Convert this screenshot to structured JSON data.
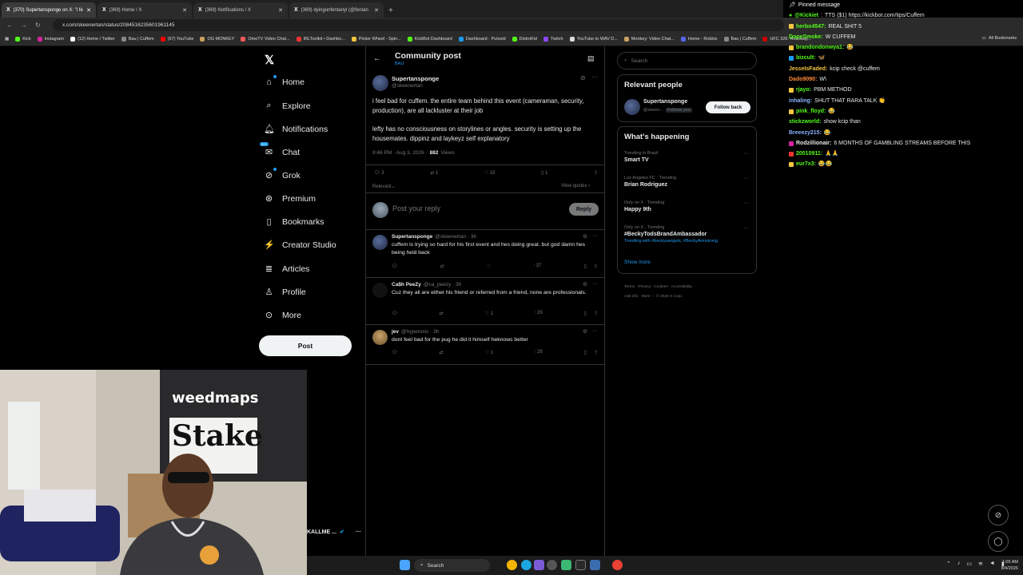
{
  "browser": {
    "tabs": [
      {
        "title": "(370) Supertansponge on X: \"i fe",
        "active": true
      },
      {
        "title": "(369) Home / X",
        "active": false
      },
      {
        "title": "(369) Notifications / X",
        "active": false
      },
      {
        "title": "(369) dyingonfentanyl (@fentan",
        "active": false
      }
    ],
    "url": "x.com/skeenertan/status/2084516235601961145",
    "bookmarks": [
      "Kick",
      "Instagram",
      "(12) Home / Twitter",
      "Bau | Cuffem",
      "(57) YouTube",
      "OG MONKEY",
      "OmeTV Video Chat...",
      "IRLToolkit • Dashbo...",
      "Picker Wheel - Spin...",
      "KickBot Dashboard",
      "Dashboard - Pulsoid",
      "DistroKid",
      "Twitch",
      "YouTube to WAV D...",
      "Monkey: Video Chat...",
      "Home - Roblox",
      "Bau | Cuffem",
      "UFC 326: Holloway..."
    ],
    "all_bookmarks": "All Bookmarks"
  },
  "nav": {
    "items": [
      {
        "label": "Home",
        "icon": "home-icon",
        "glyph": "⌂"
      },
      {
        "label": "Explore",
        "icon": "search-icon",
        "glyph": "⌕"
      },
      {
        "label": "Notifications",
        "icon": "bell-icon",
        "glyph": "♫"
      },
      {
        "label": "Chat",
        "icon": "chat-icon",
        "glyph": "✉"
      },
      {
        "label": "Grok",
        "icon": "grok-icon",
        "glyph": "⊘"
      },
      {
        "label": "Premium",
        "icon": "premium-icon",
        "glyph": "✓"
      },
      {
        "label": "Bookmarks",
        "icon": "bookmark-icon",
        "glyph": "▯"
      },
      {
        "label": "Creator Studio",
        "icon": "creator-studio-icon",
        "glyph": "⚡"
      },
      {
        "label": "Articles",
        "icon": "articles-icon",
        "glyph": "≣"
      },
      {
        "label": "Profile",
        "icon": "profile-icon",
        "glyph": "♙"
      },
      {
        "label": "More",
        "icon": "more-icon",
        "glyph": "⋯"
      }
    ],
    "post_button": "Post",
    "bottom_user": "KALLME ..."
  },
  "main": {
    "title": "Community post",
    "subtitle": "BAU",
    "post": {
      "name": "Supertansponge",
      "handle": "@skeenertan",
      "text1": "i feel bad for cuffem. the entire team behind this event (cameraman, security, production), are all lackluster at their job",
      "text2": "lefty has no consciousness on storylines or angles. security is setting up the housemates. dippinz and laykeyz self explanatory",
      "meta_time": "9:46 PM · Aug 3, 2026 ·",
      "views": "882",
      "views_label": "Views",
      "replies": "3",
      "reposts": "1",
      "likes": "15",
      "bookmarks": "1",
      "relevant": "Relevant",
      "view_quotes": "View quotes"
    },
    "composer": {
      "placeholder": "Post your reply",
      "button": "Reply"
    },
    "replies": [
      {
        "name": "Supertansponge",
        "handle": "@skeenertan · 3h",
        "text": "cuffem is trying so hard for his first event and hes doing great. but god damn hes being held back",
        "replies": "",
        "reposts": "",
        "likes": "",
        "views": "37"
      },
      {
        "name": "Ca$h PeeZy",
        "handle": "@ca_peezy · 3h",
        "text": "Cuz they all are either his friend or referred from a friend, none are professionals.",
        "replies": "",
        "reposts": "",
        "likes": "1",
        "views": "29"
      },
      {
        "name": "jev",
        "handle": "@hyperoxic · 3h",
        "text": "dont feel bad for the pug he did it himself heknows better",
        "replies": "",
        "reposts": "",
        "likes": "1",
        "views": "28"
      }
    ]
  },
  "right": {
    "search_placeholder": "Search",
    "relevant_title": "Relevant people",
    "person": {
      "name": "Supertansponge",
      "handle": "@skeen...",
      "follows": "Follows you",
      "button": "Follow back"
    },
    "happening_title": "What's happening",
    "trends": [
      {
        "context": "Trending in Brazil",
        "title": "Smart TV",
        "extra": ""
      },
      {
        "context": "Los Angeles FC · Trending",
        "title": "Brian Rodriguez",
        "extra": ""
      },
      {
        "context": "Only on X · Trending",
        "title": "Happy 9th",
        "extra": ""
      },
      {
        "context": "Only on X · Trending",
        "title": "#BeckyTodsBrandAmbassador",
        "extra": "Trending with #beckysangels, #BeckyArmstrong"
      }
    ],
    "show_more": "Show more",
    "footer1": "Terms · Privacy · Cookies · Accessibility ·",
    "footer2": "Ads info · More ··· © 2026 X Corp."
  },
  "chat": {
    "pinned_title": "Pinned message",
    "pinned_user": "@Kickiet",
    "pinned_text": "TTS ($1) https://kickbot.com/tips/Cuffem",
    "messages": [
      {
        "user": "herbo4547:",
        "color": "#53fc18",
        "text": "REAL SHIT 5"
      },
      {
        "user": "DopeSmoke:",
        "color": "#53fc18",
        "text": "W CUFFEM"
      },
      {
        "user": "brandondonwya1:",
        "color": "#53fc18",
        "text": "😂"
      },
      {
        "user": "bizcult:",
        "color": "#53fc18",
        "text": "🦋"
      },
      {
        "user": "JesseIsFaded:",
        "color": "#f5c542",
        "text": "kcip check @cuffem"
      },
      {
        "user": "Dado9090:",
        "color": "#ff8a3d",
        "text": "W\\"
      },
      {
        "user": "rjayo:",
        "color": "#53fc18",
        "text": "PBM METHOD"
      },
      {
        "user": "inhaling:",
        "color": "#8ab4ff",
        "text": "SHUT THAT RARA TALK 👏"
      },
      {
        "user": "pink_floyd:",
        "color": "#53fc18",
        "text": "😂"
      },
      {
        "user": "stickzworld:",
        "color": "#53fc18",
        "text": "show kcip than"
      },
      {
        "user": "Breeezy215:",
        "color": "#8ab4ff",
        "text": "😂"
      },
      {
        "user": "Rodzillionair:",
        "color": "#e7e9ea",
        "text": "6 MONTHS OF GAMBLING STREAMS BEFORE THIS"
      },
      {
        "user": "20010911:",
        "color": "#53fc18",
        "text": "🙏🙏"
      },
      {
        "user": "eur7x3:",
        "color": "#53fc18",
        "text": "😂😂"
      }
    ]
  },
  "taskbar": {
    "search": "Search",
    "time": "1:05 AM",
    "date": "8/4/2026"
  },
  "stream": {
    "banner_text": "weedmaps",
    "banner_text2": "Stake"
  },
  "colors": {
    "accent": "#1d9bf0",
    "bg": "#000000",
    "border": "#2f3336",
    "kick_green": "#53fc18"
  }
}
